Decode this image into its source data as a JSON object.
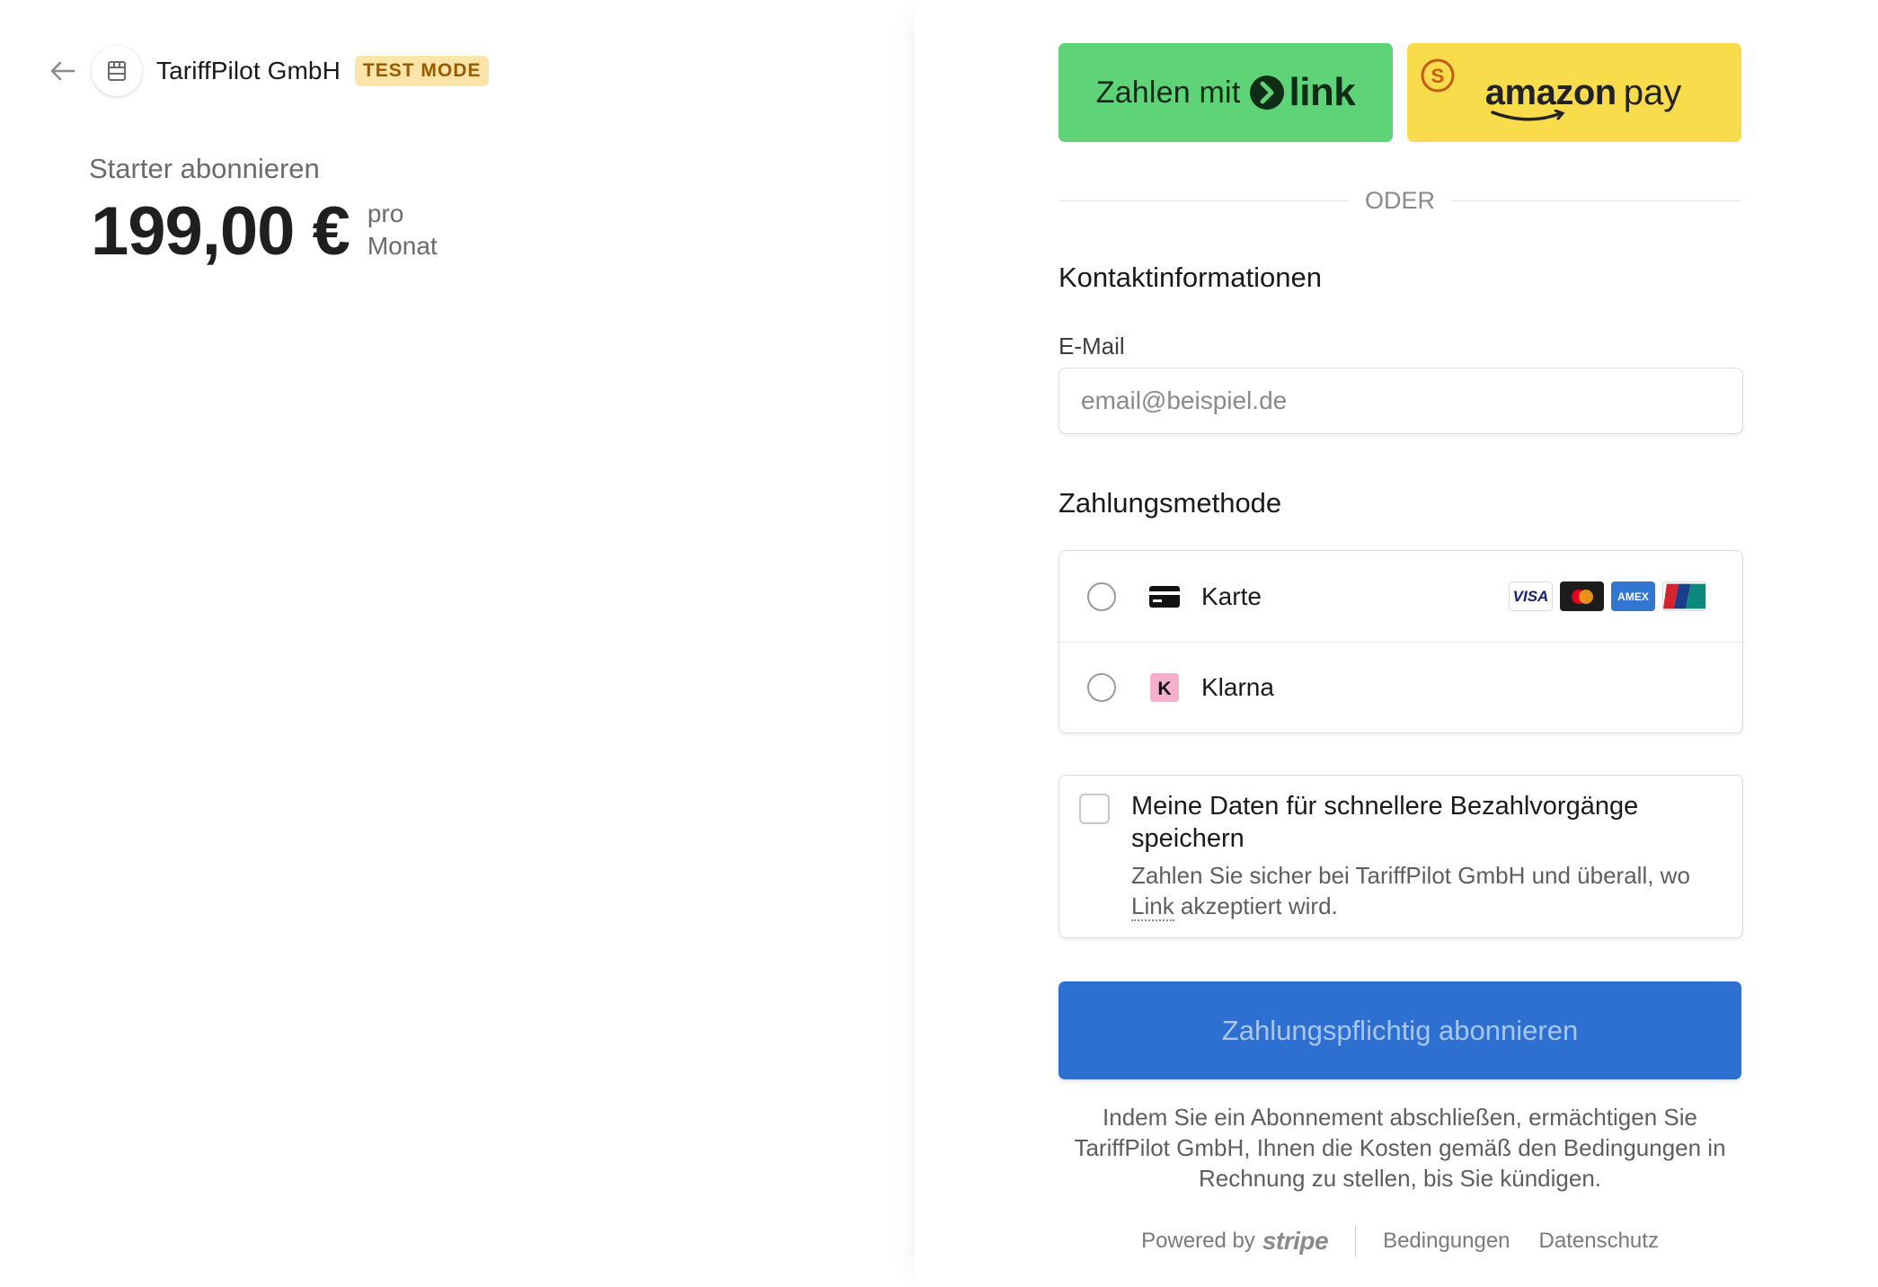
{
  "merchant": {
    "name": "TariffPilot GmbH",
    "badge": "TEST MODE"
  },
  "product": {
    "title": "Starter abonnieren",
    "price": "199,00 €",
    "interval_line1": "pro",
    "interval_line2": "Monat"
  },
  "wallets": {
    "link_prefix": "Zahlen mit",
    "link_word": "link",
    "amazon_word": "amazon",
    "pay_word": "pay"
  },
  "divider_text": "ODER",
  "contact": {
    "title": "Kontaktinformationen",
    "email_label": "E-Mail",
    "email_placeholder": "email@beispiel.de",
    "email_value": ""
  },
  "payment": {
    "title": "Zahlungsmethode",
    "methods": [
      {
        "label": "Karte",
        "icon": "credit-card-icon",
        "selected": false
      },
      {
        "label": "Klarna",
        "icon": "klarna-icon",
        "selected": false
      }
    ],
    "card_brands": [
      "VISA",
      "Mastercard",
      "AMEX",
      "UnionPay"
    ]
  },
  "save": {
    "checked": false,
    "title": "Meine Daten für schnellere Bezahlvorgänge speichern",
    "desc_before": "Zahlen Sie sicher bei TariffPilot GmbH und überall, wo ",
    "desc_link": "Link",
    "desc_after": " akzeptiert wird."
  },
  "submit_label": "Zahlungspflichtig abonnieren",
  "legal_text": "Indem Sie ein Abonnement abschließen, ermächtigen Sie TariffPilot GmbH, Ihnen die Kosten gemäß den Bedingungen in Rechnung zu stellen, bis Sie kündigen.",
  "footer": {
    "powered_by": "Powered by",
    "stripe": "stripe",
    "terms": "Bedingungen",
    "privacy": "Datenschutz"
  },
  "colors": {
    "link_green": "#5fd378",
    "amazon_yellow": "#f8dc4b",
    "submit_blue": "#2e70d1",
    "badge_bg": "#fde4a8",
    "badge_text": "#9a5a00"
  }
}
